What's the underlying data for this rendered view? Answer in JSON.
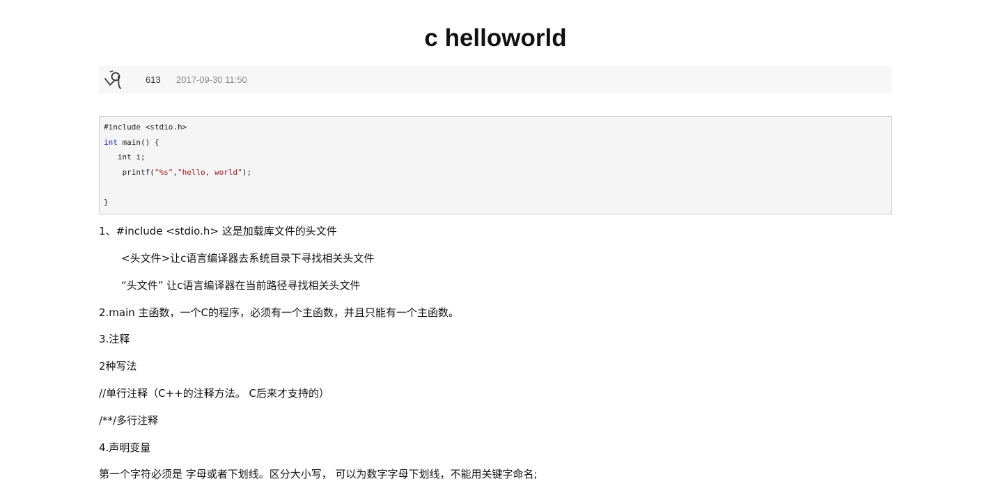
{
  "article": {
    "title": "c helloworld",
    "meta": {
      "avatar_icon": "author-avatar-icon",
      "count": "613",
      "date": "2017-09-30 11:50"
    },
    "code": {
      "line1": "#include <stdio.h>",
      "line2_kw": "int",
      "line2_rest": " main() {",
      "line3": "   int i;",
      "line4_pre": "    printf(",
      "line4_str1": "\"%s\"",
      "line4_comma": ",",
      "line4_str2": "\"hello, world\"",
      "line4_post": ");",
      "line6": "}"
    },
    "paragraphs": [
      "1、#include <stdio.h> 这是加载库文件的头文件",
      "<头文件>让c语言编译器去系统目录下寻找相关头文件",
      "“头文件” 让c语言编译器在当前路径寻找相关头文件",
      "2.main 主函数，一个C的程序，必须有一个主函数，并且只能有一个主函数。",
      "3.注释",
      "2种写法",
      "//单行注释（C++的注释方法。 C后来才支持的）",
      "/**/多行注释",
      "4.声明变量",
      "第一个字符必须是 字母或者下划线。区分大小写， 可以为数字字母下划线，不能用关键字命名;"
    ]
  }
}
